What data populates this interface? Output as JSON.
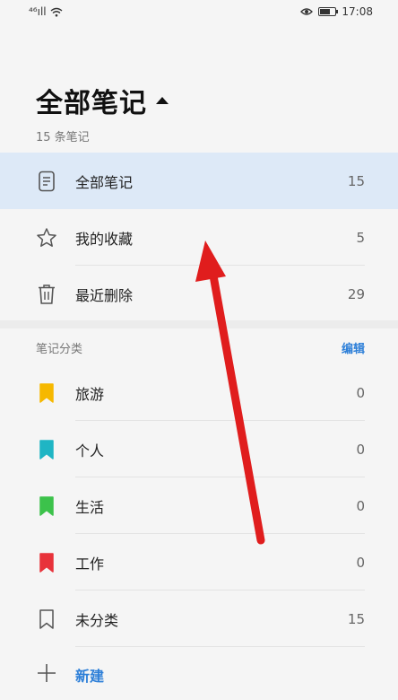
{
  "status_bar": {
    "signal_text": "⁴⁶ıll",
    "time": "17:08",
    "battery_level": 0.7
  },
  "header": {
    "title": "全部笔记",
    "subtitle": "15 条笔记"
  },
  "main_list": [
    {
      "label": "全部笔记",
      "count": "15",
      "icon": "document-icon",
      "selected": true
    },
    {
      "label": "我的收藏",
      "count": "5",
      "icon": "star-icon"
    },
    {
      "label": "最近删除",
      "count": "29",
      "icon": "trash-icon"
    }
  ],
  "categories_section": {
    "title": "笔记分类",
    "edit_label": "编辑"
  },
  "categories": [
    {
      "label": "旅游",
      "count": "0",
      "color": "#f6b800",
      "icon": "bookmark-icon"
    },
    {
      "label": "个人",
      "count": "0",
      "color": "#1fb5c4",
      "icon": "bookmark-icon"
    },
    {
      "label": "生活",
      "count": "0",
      "color": "#3cc24b",
      "icon": "bookmark-icon"
    },
    {
      "label": "工作",
      "count": "0",
      "color": "#e8323a",
      "icon": "bookmark-icon"
    },
    {
      "label": "未分类",
      "count": "15",
      "color": "#555555",
      "icon": "bookmark-outline-icon"
    }
  ],
  "new_button": {
    "label": "新建"
  },
  "overlay": {
    "arrow_color": "#e01d1d"
  }
}
